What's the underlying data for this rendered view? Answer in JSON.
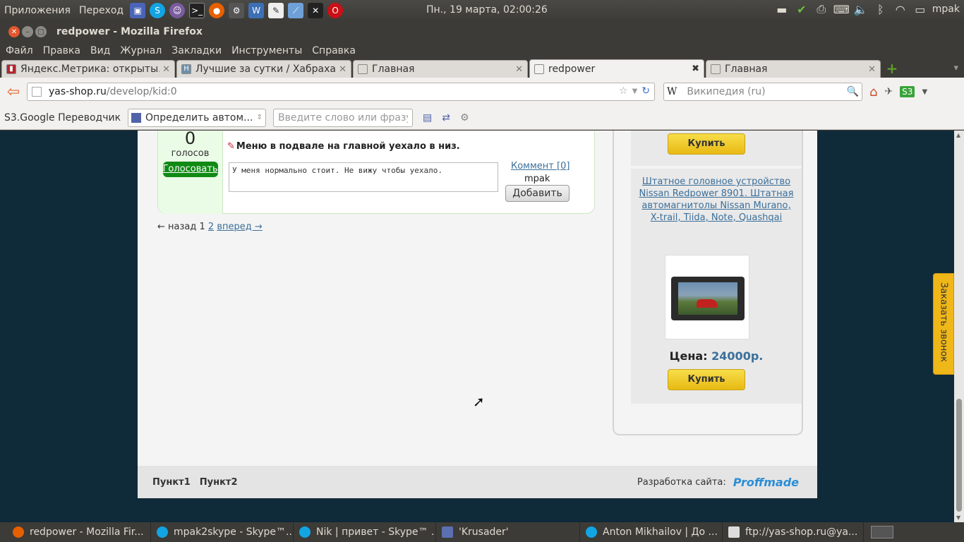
{
  "top_panel": {
    "menus": [
      "Приложения",
      "Переход"
    ],
    "clock": "Пн., 19 марта, 02:00:26",
    "user": "mpak",
    "app_icons": [
      "rdesktop-icon",
      "skype-icon",
      "pidgin-icon",
      "terminal-icon",
      "firefox-icon",
      "settings-icon",
      "writer-icon",
      "editor-icon",
      "draw-icon",
      "x-icon",
      "opera-icon"
    ],
    "tray_icons": [
      "keyboard-layout-icon",
      "update-icon",
      "printer-icon",
      "keyboard-icon",
      "volume-icon",
      "bluetooth-icon",
      "wifi-icon",
      "chat-icon"
    ]
  },
  "window": {
    "title": "redpower - Mozilla Firefox"
  },
  "menubar": [
    "Файл",
    "Правка",
    "Вид",
    "Журнал",
    "Закладки",
    "Инструменты",
    "Справка"
  ],
  "tabs": [
    {
      "label": "Яндекс.Метрика: открыты...",
      "icon": "metrika-icon"
    },
    {
      "label": "Лучшие за сутки / Хабраха...",
      "icon": "habr-icon"
    },
    {
      "label": "Главная",
      "icon": "page-icon"
    },
    {
      "label": "redpower",
      "icon": "page-icon",
      "active": true
    },
    {
      "label": "Главная",
      "icon": "page-icon"
    }
  ],
  "navbar": {
    "url_host": "yas-shop.ru",
    "url_path": "/develop/kid:0",
    "search_engine": "W",
    "search_placeholder": "Википедия (ru)"
  },
  "translator_bar": {
    "label": "S3.Google Переводчик",
    "language": "Определить автом...",
    "input_placeholder": "Введите слово или фразу"
  },
  "comment": {
    "votes": "0",
    "votes_label": "голосов",
    "vote_button": "Голосовать",
    "title": "Меню в подвале на главной уехало в низ.",
    "text": "У меня нормально стоит. Не вижу чтобы уехало.",
    "comment_link": "Коммент [0]",
    "author": "mpak",
    "add_button": "Добавить"
  },
  "pager": {
    "prev": "← назад",
    "current": "1",
    "page2": "2",
    "next": "вперед →"
  },
  "sidebar": {
    "buy_top": "Купить",
    "product": {
      "name": "Штатное головное устройство Nissan Redpower 8901. Штатная автомагнитолы Nissan Murano, X-trail, Tiida, Note, Quashqai",
      "price_label": "Цена:",
      "price_value": "24000р.",
      "buy": "Купить"
    }
  },
  "callback_tab": "Заказать звонок",
  "footer": {
    "links": [
      "Пункт1",
      "Пункт2"
    ],
    "dev_label": "Разработка сайта:",
    "dev_logo": "Proffmade"
  },
  "taskbar": [
    {
      "label": "redpower - Mozilla Fir...",
      "icon": "firefox-icon"
    },
    {
      "label": "mpak2skype - Skype™...",
      "icon": "skype-icon"
    },
    {
      "label": "Nik | привет - Skype™ ...",
      "icon": "skype-icon"
    },
    {
      "label": "'Krusader'",
      "icon": "krusader-icon"
    },
    {
      "label": "Anton Mikhailov | До ...",
      "icon": "skype-icon"
    },
    {
      "label": "ftp://yas-shop.ru@ya...",
      "icon": "editor-icon"
    }
  ]
}
